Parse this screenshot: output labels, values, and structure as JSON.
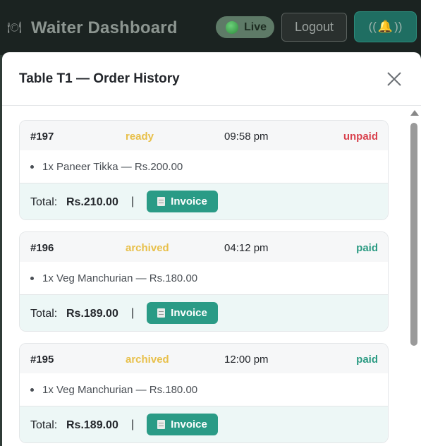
{
  "header": {
    "brand_icon": "plate-icon",
    "title": "Waiter Dashboard",
    "live_label": "Live",
    "logout_label": "Logout",
    "bell_button": {
      "left": "((",
      "icon": "bell-icon",
      "glyph": "🔔",
      "right": "))"
    }
  },
  "modal": {
    "title": "Table T1 — Order History",
    "close_icon": "close-icon",
    "orders": [
      {
        "id": "#197",
        "status": "ready",
        "time": "09:58 pm",
        "payment": "unpaid",
        "item": "1x Paneer Tikka — Rs.200.00",
        "total_label": "Total:",
        "total": "Rs.210.00",
        "separator": "|",
        "invoice_label": "Invoice"
      },
      {
        "id": "#196",
        "status": "archived",
        "time": "04:12 pm",
        "payment": "paid",
        "item": "1x Veg Manchurian — Rs.180.00",
        "total_label": "Total:",
        "total": "Rs.189.00",
        "separator": "|",
        "invoice_label": "Invoice"
      },
      {
        "id": "#195",
        "status": "archived",
        "time": "12:00 pm",
        "payment": "paid",
        "item": "1x Veg Manchurian — Rs.180.00",
        "total_label": "Total:",
        "total": "Rs.189.00",
        "separator": "|",
        "invoice_label": "Invoice"
      }
    ]
  },
  "colors": {
    "accent": "#2a9b86",
    "status_ready": "#e8c04a",
    "unpaid": "#d9434f",
    "paid": "#2c9b83"
  }
}
